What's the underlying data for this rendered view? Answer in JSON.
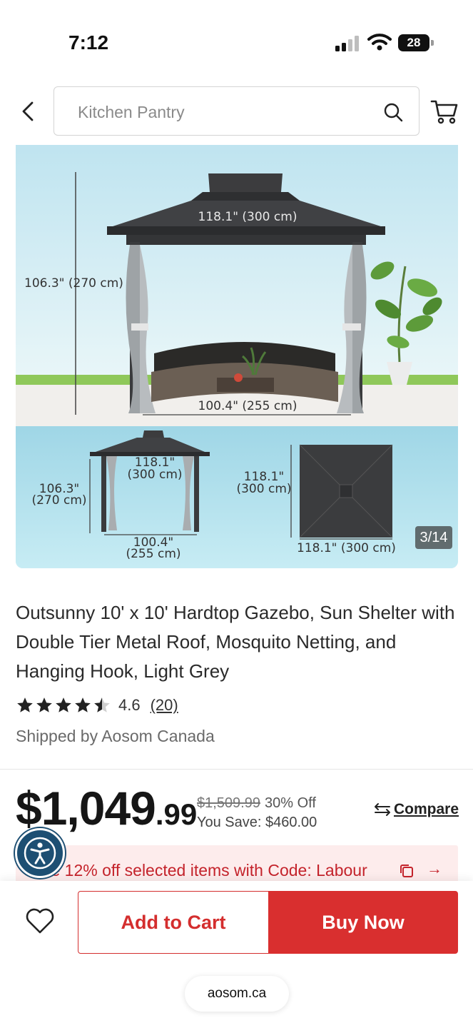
{
  "status_bar": {
    "time": "7:12",
    "battery": "28"
  },
  "header": {
    "search_placeholder": "Kitchen Pantry",
    "icons": {
      "back": "chevron-left-icon",
      "search": "search-icon",
      "cart": "cart-icon"
    }
  },
  "gallery": {
    "counter": "3/14",
    "labels": {
      "main_height": "106.3\" (270 cm)",
      "main_roof": "118.1\" (300 cm)",
      "main_base": "100.4\" (255 cm)",
      "small_roof_l1": "118.1\"",
      "small_roof_l2": "(300 cm)",
      "small_height_l1": "106.3\"",
      "small_height_l2": "(270 cm)",
      "small_base_l1": "100.4\"",
      "small_base_l2": "(255 cm)",
      "top_side_l1": "118.1\"",
      "top_side_l2": "(300 cm)",
      "top_bottom": "118.1\" (300 cm)"
    }
  },
  "product": {
    "title": "Outsunny 10' x 10' Hardtop Gazebo, Sun Shelter with Double Tier Metal Roof, Mosquito Netting, and Hanging Hook, Light Grey",
    "rating": 4.6,
    "rating_text": "4.6",
    "review_count": "(20)",
    "shipped_by": "Shipped by Aosom Canada"
  },
  "pricing": {
    "price_dollars": "$1,049",
    "price_cents": ".99",
    "was_price": "$1,509.99",
    "discount": "30% Off",
    "you_save": "You Save: $460.00",
    "compare_label": "Compare"
  },
  "promo": {
    "text": "ve 12% off selected items with Code: Labour",
    "arrow": "→"
  },
  "actions": {
    "add_to_cart": "Add to Cart",
    "buy_now": "Buy Now"
  },
  "browser": {
    "url": "aosom.ca"
  },
  "colors": {
    "brand_red": "#d92f2f",
    "accessibility_blue": "#1d4f73"
  }
}
